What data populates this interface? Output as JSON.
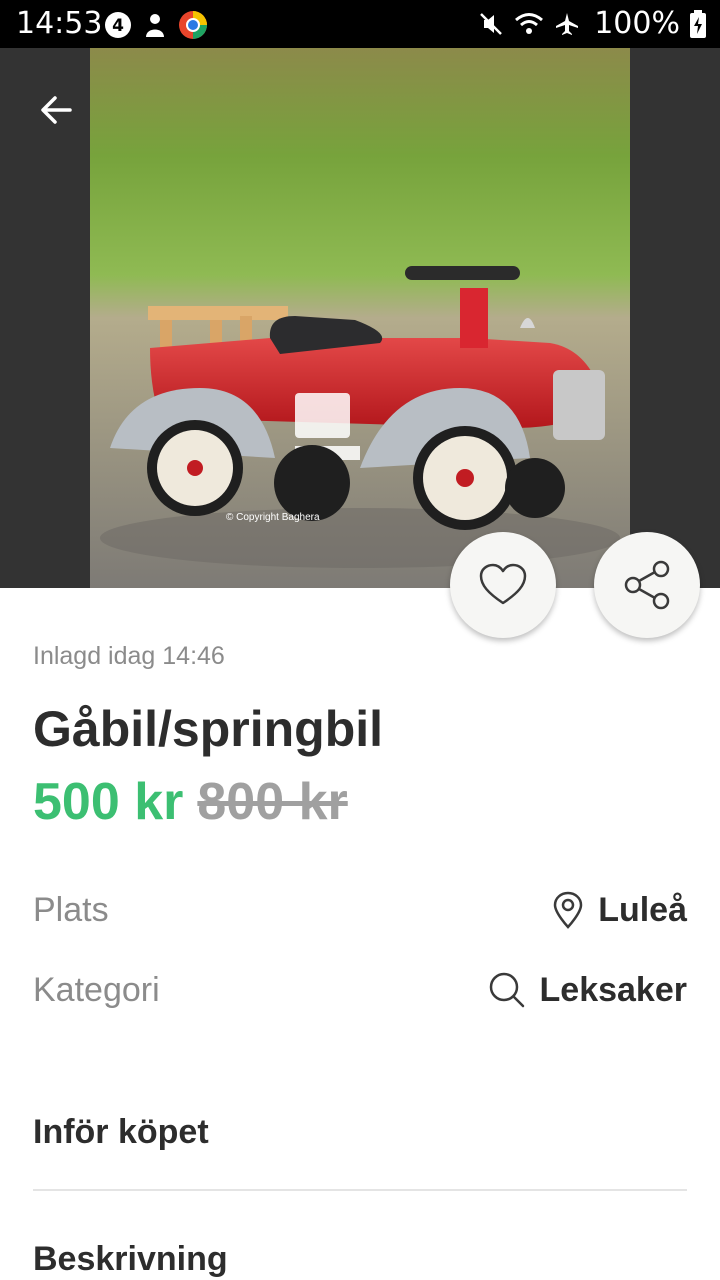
{
  "status_bar": {
    "time": "14:53",
    "battery": "100%"
  },
  "listing": {
    "posted": "Inlagd idag 14:46",
    "title": "Gåbil/springbil",
    "price_current": "500 kr",
    "price_original": "800 kr",
    "image_caption": "© Copyright Baghera"
  },
  "details": {
    "location_label": "Plats",
    "location_value": "Luleå",
    "category_label": "Kategori",
    "category_value": "Leksaker"
  },
  "sections": {
    "before_purchase": "Inför köpet",
    "description": "Beskrivning"
  },
  "colors": {
    "price_green": "#3cbf72",
    "hero_background": "#333333"
  }
}
